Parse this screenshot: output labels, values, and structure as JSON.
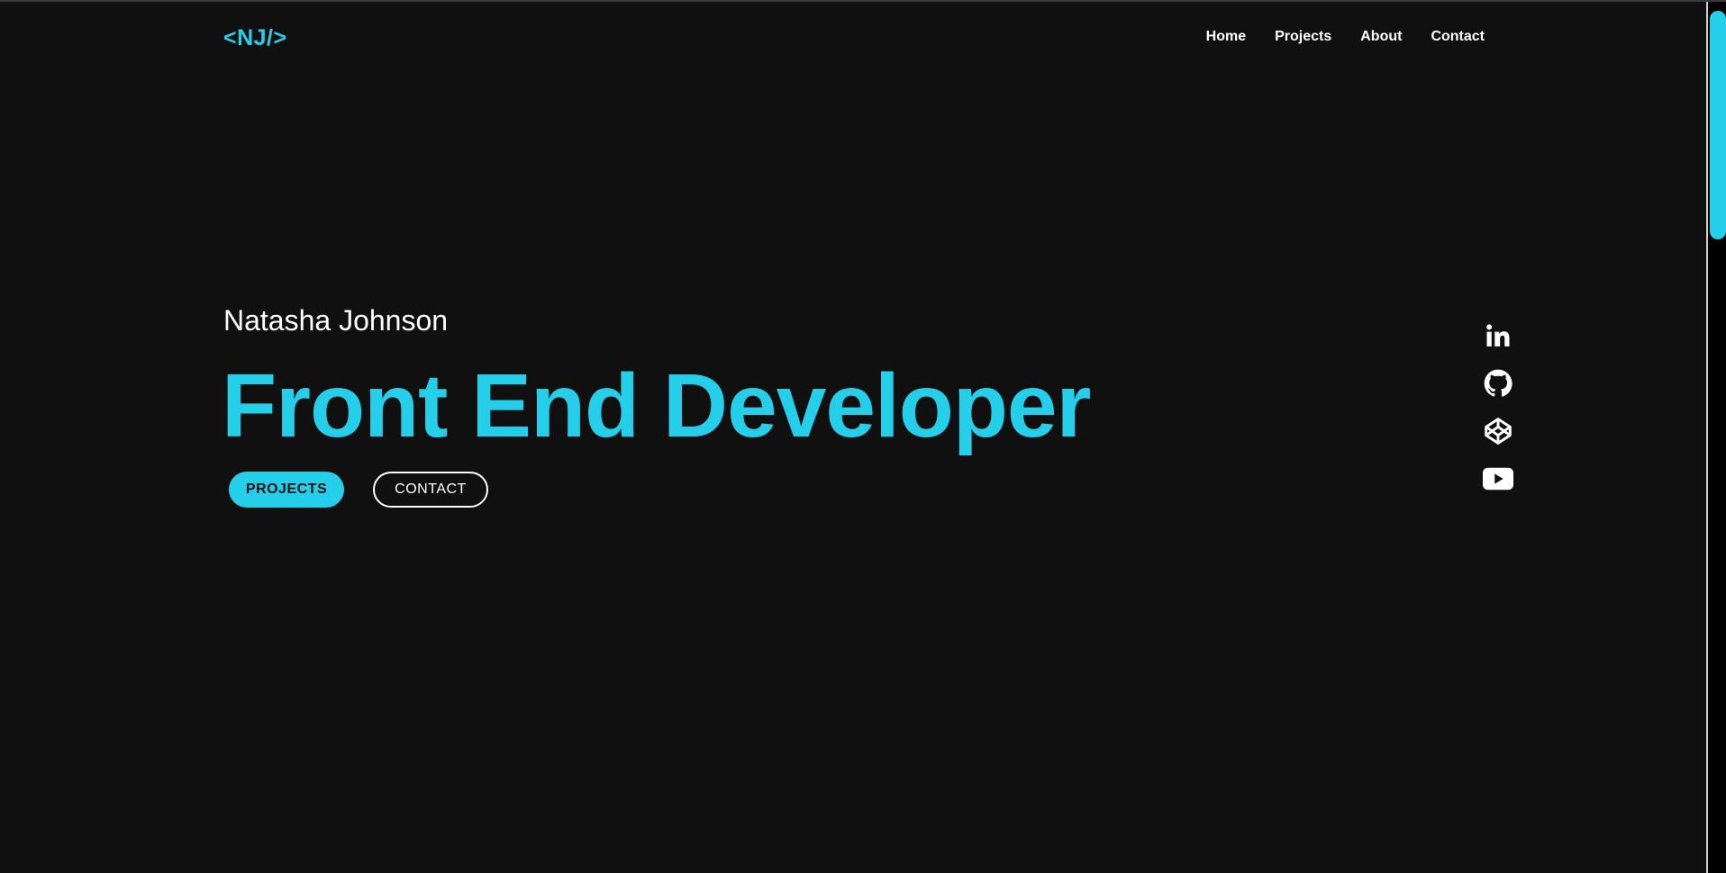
{
  "header": {
    "logo": "<NJ/>",
    "nav": [
      "Home",
      "Projects",
      "About",
      "Contact"
    ]
  },
  "hero": {
    "name": "Natasha Johnson",
    "title": "Front End Developer",
    "buttons": {
      "projects": "PROJECTS",
      "contact": "CONTACT"
    }
  },
  "social": [
    {
      "icon": "linkedin-icon"
    },
    {
      "icon": "github-icon"
    },
    {
      "icon": "codepen-icon"
    },
    {
      "icon": "youtube-icon"
    }
  ],
  "colors": {
    "background": "#101010",
    "accent": "#25cfea",
    "text": "#ffffff"
  },
  "scroll": {
    "position_fraction": 0.0,
    "visible_fraction": 0.27
  }
}
